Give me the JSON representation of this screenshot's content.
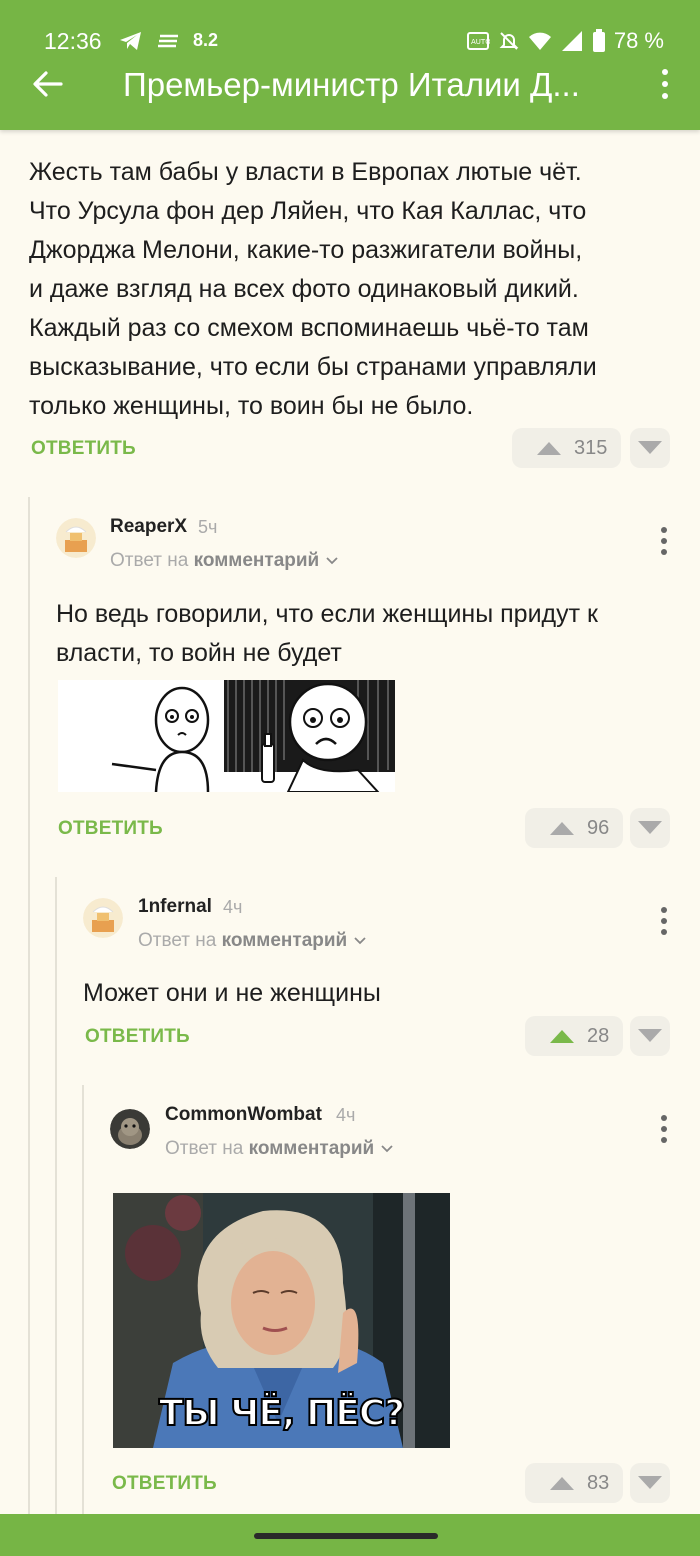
{
  "status": {
    "time": "12:36",
    "speed": "8.2",
    "battery": "78 %"
  },
  "header": {
    "title": "Премьер-министр Италии Д..."
  },
  "post": {
    "lines": [
      "Жесть там бабы у власти в Европах лютые чёт.",
      "Что Урсула фон дер Ляйен, что Кая Каллас, что",
      "Джорджа Мелони, какие-то разжигатели войны,",
      "и даже взгляд на всех фото одинаковый дикий.",
      "Каждый раз со смехом вспоминаешь чьё-то там",
      "высказывание, что если бы странами управляли",
      "только женщины, то воин бы не было."
    ],
    "reply_label": "ОТВЕТИТЬ",
    "votes": "315"
  },
  "comments": [
    {
      "author": "ReaperX",
      "age": "5ч",
      "reply_prefix": "Ответ на",
      "reply_target": "комментарий",
      "lines": [
        "Но ведь говорили, что если женщины придут к",
        "власти, то войн не будет"
      ],
      "reply_label": "ОТВЕТИТЬ",
      "votes": "96"
    },
    {
      "author": "1nfernal",
      "age": "4ч",
      "reply_prefix": "Ответ на",
      "reply_target": "комментарий",
      "lines": [
        "Может они и не женщины"
      ],
      "reply_label": "ОТВЕТИТЬ",
      "votes": "28"
    },
    {
      "author": "CommonWombat",
      "age": "4ч",
      "reply_prefix": "Ответ на",
      "reply_target": "комментарий",
      "image_caption": "ТЫ ЧЁ, ПЁС?",
      "reply_label": "ОТВЕТИТЬ",
      "votes": "83"
    }
  ],
  "colors": {
    "brand": "#76b545",
    "accent_text": "#7ab94a",
    "background": "#fdfaf0"
  }
}
